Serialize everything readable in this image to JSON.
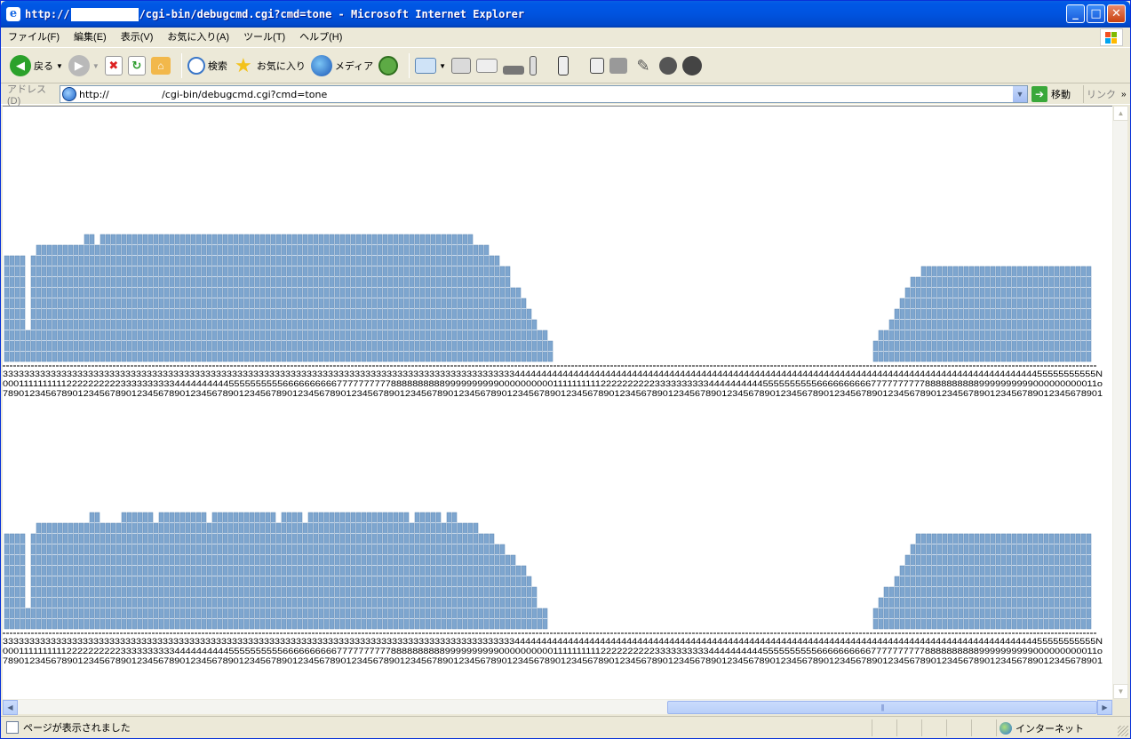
{
  "window": {
    "title_prefix": "http://",
    "title_suffix": "/cgi-bin/debugcmd.cgi?cmd=tone - Microsoft Internet Explorer",
    "minimize": "_",
    "maximize": "□",
    "close": "✕"
  },
  "menubar": {
    "items": [
      "ファイル(F)",
      "編集(E)",
      "表示(V)",
      "お気に入り(A)",
      "ツール(T)",
      "ヘルプ(H)"
    ]
  },
  "toolbar": {
    "back_label": "戻る",
    "search_label": "検索",
    "favorites_label": "お気に入り",
    "media_label": "メディア"
  },
  "addressbar": {
    "label": "アドレス(D)",
    "url": "http://                 /cgi-bin/debugcmd.cgi?cmd=tone",
    "go_label": "移動",
    "links_label": "リンク"
  },
  "statusbar": {
    "text": "ページが表示されました",
    "zone": "インターネット"
  },
  "colors": {
    "bar_fill": "#7EA6CF",
    "bar_stroke": "#5E87B4"
  },
  "page": {
    "panels": [
      {
        "columns": [
          {
            "start": 0,
            "end": 3,
            "height": 10
          },
          {
            "start": 4,
            "end": 4,
            "height": 3
          },
          {
            "start": 5,
            "end": 5,
            "height": 10
          },
          {
            "start": 6,
            "end": 14,
            "height": 11
          },
          {
            "start": 15,
            "end": 16,
            "height": 12
          },
          {
            "start": 17,
            "end": 17,
            "height": 11
          },
          {
            "start": 18,
            "end": 87,
            "height": 12
          },
          {
            "start": 88,
            "end": 90,
            "height": 11
          },
          {
            "start": 91,
            "end": 92,
            "height": 10
          },
          {
            "start": 93,
            "end": 94,
            "height": 9
          },
          {
            "start": 95,
            "end": 96,
            "height": 7
          },
          {
            "start": 97,
            "end": 97,
            "height": 6
          },
          {
            "start": 98,
            "end": 98,
            "height": 5
          },
          {
            "start": 99,
            "end": 99,
            "height": 4
          },
          {
            "start": 100,
            "end": 101,
            "height": 3
          },
          {
            "start": 102,
            "end": 102,
            "height": 2
          },
          {
            "start": 163,
            "end": 163,
            "height": 2
          },
          {
            "start": 164,
            "end": 165,
            "height": 3
          },
          {
            "start": 166,
            "end": 166,
            "height": 4
          },
          {
            "start": 167,
            "end": 167,
            "height": 5
          },
          {
            "start": 168,
            "end": 168,
            "height": 6
          },
          {
            "start": 169,
            "end": 169,
            "height": 7
          },
          {
            "start": 170,
            "end": 171,
            "height": 8
          },
          {
            "start": 172,
            "end": 203,
            "height": 9
          }
        ],
        "rows": [
          "3333333333333333333333333333333333333333333333333333333333333333333333333333333333333333333333334444444444444444444444444444444444444444444444444444444444444444444444444444444444444444444444444455555555555N",
          "0001111111111222222222233333333334444444444555555555566666666667777777777888888888899999999990000000000111111111122222222223333333333444444444455555555556666666666777777777788888888889999999999000000000011o",
          "7890123456789012345678901234567890123456789012345678901234567890123456789012345678901234567890123456789012345678901234567890123456789012345678901234567890123456789012345678901234567890123456789012345678901"
        ]
      },
      {
        "columns": [
          {
            "start": 0,
            "end": 3,
            "height": 9
          },
          {
            "start": 4,
            "end": 4,
            "height": 2
          },
          {
            "start": 5,
            "end": 5,
            "height": 9
          },
          {
            "start": 6,
            "end": 15,
            "height": 10
          },
          {
            "start": 16,
            "end": 17,
            "height": 11
          },
          {
            "start": 18,
            "end": 21,
            "height": 10
          },
          {
            "start": 22,
            "end": 27,
            "height": 11
          },
          {
            "start": 28,
            "end": 28,
            "height": 10
          },
          {
            "start": 29,
            "end": 37,
            "height": 11
          },
          {
            "start": 38,
            "end": 38,
            "height": 10
          },
          {
            "start": 39,
            "end": 50,
            "height": 11
          },
          {
            "start": 51,
            "end": 51,
            "height": 10
          },
          {
            "start": 52,
            "end": 55,
            "height": 11
          },
          {
            "start": 56,
            "end": 56,
            "height": 10
          },
          {
            "start": 57,
            "end": 75,
            "height": 11
          },
          {
            "start": 76,
            "end": 76,
            "height": 10
          },
          {
            "start": 77,
            "end": 81,
            "height": 11
          },
          {
            "start": 82,
            "end": 82,
            "height": 10
          },
          {
            "start": 83,
            "end": 84,
            "height": 11
          },
          {
            "start": 85,
            "end": 88,
            "height": 10
          },
          {
            "start": 89,
            "end": 91,
            "height": 9
          },
          {
            "start": 92,
            "end": 93,
            "height": 8
          },
          {
            "start": 94,
            "end": 95,
            "height": 7
          },
          {
            "start": 96,
            "end": 97,
            "height": 6
          },
          {
            "start": 98,
            "end": 98,
            "height": 5
          },
          {
            "start": 99,
            "end": 99,
            "height": 4
          },
          {
            "start": 100,
            "end": 101,
            "height": 2
          },
          {
            "start": 163,
            "end": 163,
            "height": 2
          },
          {
            "start": 164,
            "end": 164,
            "height": 3
          },
          {
            "start": 165,
            "end": 166,
            "height": 4
          },
          {
            "start": 167,
            "end": 167,
            "height": 5
          },
          {
            "start": 168,
            "end": 168,
            "height": 6
          },
          {
            "start": 169,
            "end": 169,
            "height": 7
          },
          {
            "start": 170,
            "end": 170,
            "height": 8
          },
          {
            "start": 171,
            "end": 203,
            "height": 9
          }
        ],
        "rows": [
          "3333333333333333333333333333333333333333333333333333333333333333333333333333333333333333333333334444444444444444444444444444444444444444444444444444444444444444444444444444444444444444444444444455555555555N",
          "0001111111111222222222233333333334444444444555555555566666666667777777777888888888899999999990000000000111111111122222222223333333333444444444455555555556666666666777777777788888888889999999999000000000011o",
          "7890123456789012345678901234567890123456789012345678901234567890123456789012345678901234567890123456789012345678901234567890123456789012345678901234567890123456789012345678901234567890123456789012345678901"
        ]
      }
    ]
  }
}
